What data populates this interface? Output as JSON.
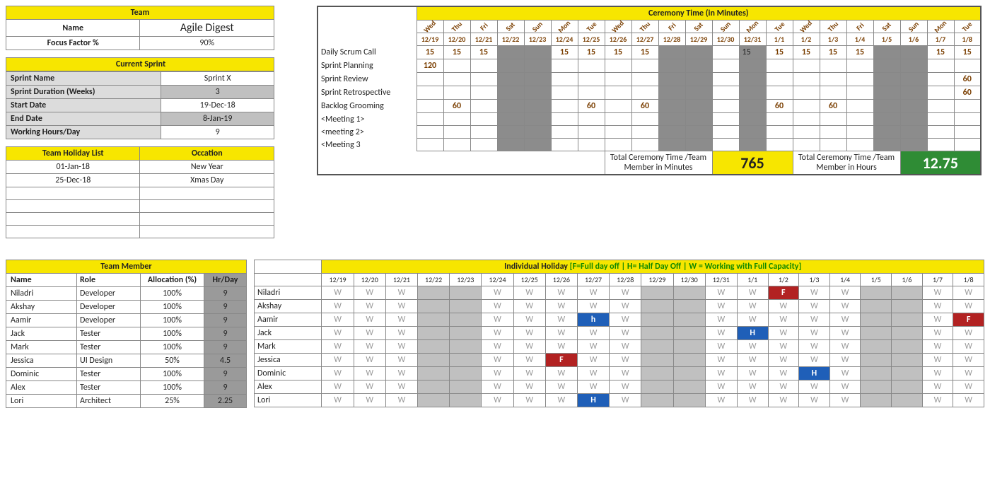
{
  "team": {
    "header": "Team",
    "name_label": "Name",
    "name_value": "Agile Digest",
    "focus_label": "Focus Factor %",
    "focus_value": "90%"
  },
  "sprint": {
    "header": "Current Sprint",
    "rows": [
      {
        "label": "Sprint Name",
        "value": "Sprint X"
      },
      {
        "label": "Sprint Duration (Weeks)",
        "value": "3",
        "grey_val": true
      },
      {
        "label": "Start Date",
        "value": "19-Dec-18"
      },
      {
        "label": "End Date",
        "value": "8-Jan-19",
        "grey_val": true
      },
      {
        "label": "Working Hours/Day",
        "value": "9"
      }
    ]
  },
  "holidays": {
    "h1": "Team Holiday List",
    "h2": "Occation",
    "rows": [
      {
        "date": "01-Jan-18",
        "occ": "New Year"
      },
      {
        "date": "25-Dec-18",
        "occ": "Xmas Day"
      },
      {
        "date": "",
        "occ": ""
      },
      {
        "date": "",
        "occ": ""
      },
      {
        "date": "",
        "occ": ""
      },
      {
        "date": "",
        "occ": ""
      }
    ]
  },
  "ceremony": {
    "title": "Ceremony Time (in Minutes)",
    "days": [
      "Wed",
      "Thu",
      "Fri",
      "Sat",
      "Sun",
      "Mon",
      "Tue",
      "Wed",
      "Thu",
      "Fri",
      "Sat",
      "Sun",
      "Mon",
      "Tue",
      "Wed",
      "Thu",
      "Fri",
      "Sat",
      "Sun",
      "Mon",
      "Tue"
    ],
    "dates": [
      "12/19",
      "12/20",
      "12/21",
      "12/22",
      "12/23",
      "12/24",
      "12/25",
      "12/26",
      "12/27",
      "12/28",
      "12/29",
      "12/30",
      "12/31",
      "1/1",
      "1/2",
      "1/3",
      "1/4",
      "1/5",
      "1/6",
      "1/7",
      "1/8"
    ],
    "grey_cols": [
      3,
      4,
      9,
      10,
      12,
      17,
      18
    ],
    "rows": [
      {
        "name": "Daily Scrum Call",
        "vals": [
          "15",
          "15",
          "15",
          "",
          "",
          "15",
          "15",
          "15",
          "15",
          "",
          "",
          "",
          "15",
          "15",
          "15",
          "15",
          "15",
          "",
          "",
          "15",
          "15"
        ]
      },
      {
        "name": "Sprint Planning",
        "vals": [
          "120",
          "",
          "",
          "",
          "",
          "",
          "",
          "",
          "",
          "",
          "",
          "",
          "",
          "",
          "",
          "",
          "",
          "",
          "",
          "",
          ""
        ]
      },
      {
        "name": "Sprint Review",
        "vals": [
          "",
          "",
          "",
          "",
          "",
          "",
          "",
          "",
          "",
          "",
          "",
          "",
          "",
          "",
          "",
          "",
          "",
          "",
          "",
          "",
          "60"
        ]
      },
      {
        "name": "Sprint Retrospective",
        "vals": [
          "",
          "",
          "",
          "",
          "",
          "",
          "",
          "",
          "",
          "",
          "",
          "",
          "",
          "",
          "",
          "",
          "",
          "",
          "",
          "",
          "60"
        ]
      },
      {
        "name": "Backlog Grooming",
        "vals": [
          "",
          "60",
          "",
          "",
          "",
          "",
          "60",
          "",
          "60",
          "",
          "",
          "",
          "",
          "60",
          "",
          "60",
          "",
          "",
          "",
          "",
          ""
        ]
      },
      {
        "name": "<Meeting 1>",
        "vals": [
          "",
          "",
          "",
          "",
          "",
          "",
          "",
          "",
          "",
          "",
          "",
          "",
          "",
          "",
          "",
          "",
          "",
          "",
          "",
          "",
          ""
        ]
      },
      {
        "name": "<meeting 2>",
        "vals": [
          "",
          "",
          "",
          "",
          "",
          "",
          "",
          "",
          "",
          "",
          "",
          "",
          "",
          "",
          "",
          "",
          "",
          "",
          "",
          "",
          ""
        ]
      },
      {
        "name": "<Meeting 3",
        "vals": [
          "",
          "",
          "",
          "",
          "",
          "",
          "",
          "",
          "",
          "",
          "",
          "",
          "",
          "",
          "",
          "",
          "",
          "",
          "",
          "",
          ""
        ]
      }
    ],
    "total_min_label": "Total Ceremony Time /Team Member in Minutes",
    "total_min_value": "765",
    "total_hr_label": "Total Ceremony Time /Team Member in Hours",
    "total_hr_value": "12.75"
  },
  "members": {
    "header": "Team Member",
    "cols": [
      "Name",
      "Role",
      "Allocation (%)",
      "Hr/Day"
    ],
    "rows": [
      {
        "name": "Niladri",
        "role": "Developer",
        "alloc": "100%",
        "hr": "9"
      },
      {
        "name": "Akshay",
        "role": "Developer",
        "alloc": "100%",
        "hr": "9"
      },
      {
        "name": "Aamir",
        "role": "Developer",
        "alloc": "100%",
        "hr": "9"
      },
      {
        "name": "Jack",
        "role": "Tester",
        "alloc": "100%",
        "hr": "9"
      },
      {
        "name": "Mark",
        "role": "Tester",
        "alloc": "100%",
        "hr": "9"
      },
      {
        "name": "Jessica",
        "role": "UI Design",
        "alloc": "50%",
        "hr": "4.5"
      },
      {
        "name": "Dominic",
        "role": "Tester",
        "alloc": "100%",
        "hr": "9"
      },
      {
        "name": "Alex",
        "role": "Tester",
        "alloc": "100%",
        "hr": "9"
      },
      {
        "name": "Lori",
        "role": "Architect",
        "alloc": "25%",
        "hr": "2.25"
      }
    ]
  },
  "indiv": {
    "title": "Individual Holiday",
    "legend": "[F=Full day off | H= Half Day Off | W = Working with Full Capacity]",
    "dates": [
      "12/19",
      "12/20",
      "12/21",
      "12/22",
      "12/23",
      "12/24",
      "12/25",
      "12/26",
      "12/27",
      "12/28",
      "12/29",
      "12/30",
      "12/31",
      "1/1",
      "1/2",
      "1/3",
      "1/4",
      "1/5",
      "1/6",
      "1/7",
      "1/8"
    ],
    "grey_cols": [
      3,
      4,
      10,
      11,
      17,
      18
    ],
    "rows": [
      {
        "name": "Niladri",
        "vals": [
          "W",
          "W",
          "W",
          "",
          "",
          "W",
          "W",
          "W",
          "W",
          "W",
          "",
          "",
          "W",
          "W",
          "F",
          "W",
          "W",
          "",
          "",
          "W",
          "W"
        ]
      },
      {
        "name": "Akshay",
        "vals": [
          "W",
          "W",
          "W",
          "",
          "",
          "W",
          "W",
          "W",
          "W",
          "W",
          "",
          "",
          "W",
          "W",
          "W",
          "W",
          "W",
          "",
          "",
          "W",
          "W"
        ]
      },
      {
        "name": "Aamir",
        "vals": [
          "W",
          "W",
          "W",
          "",
          "",
          "W",
          "W",
          "W",
          "h",
          "W",
          "",
          "",
          "W",
          "W",
          "W",
          "W",
          "W",
          "",
          "",
          "W",
          "F"
        ]
      },
      {
        "name": "Jack",
        "vals": [
          "W",
          "W",
          "W",
          "",
          "",
          "W",
          "W",
          "W",
          "W",
          "W",
          "",
          "",
          "W",
          "H",
          "W",
          "W",
          "W",
          "",
          "",
          "W",
          "W"
        ]
      },
      {
        "name": "Mark",
        "vals": [
          "W",
          "W",
          "W",
          "",
          "",
          "W",
          "W",
          "W",
          "W",
          "W",
          "",
          "",
          "W",
          "W",
          "W",
          "W",
          "W",
          "",
          "",
          "W",
          "W"
        ]
      },
      {
        "name": "Jessica",
        "vals": [
          "W",
          "W",
          "W",
          "",
          "",
          "W",
          "W",
          "F",
          "W",
          "W",
          "",
          "",
          "W",
          "W",
          "W",
          "W",
          "W",
          "",
          "",
          "W",
          "W"
        ]
      },
      {
        "name": "Dominic",
        "vals": [
          "W",
          "W",
          "W",
          "",
          "",
          "W",
          "W",
          "W",
          "W",
          "W",
          "",
          "",
          "W",
          "W",
          "W",
          "H",
          "W",
          "",
          "",
          "W",
          "W"
        ]
      },
      {
        "name": "Alex",
        "vals": [
          "W",
          "W",
          "W",
          "",
          "",
          "W",
          "W",
          "W",
          "W",
          "W",
          "",
          "",
          "W",
          "W",
          "W",
          "W",
          "W",
          "",
          "",
          "W",
          "W"
        ]
      },
      {
        "name": "Lori",
        "vals": [
          "W",
          "W",
          "W",
          "",
          "",
          "W",
          "W",
          "W",
          "H",
          "W",
          "",
          "",
          "W",
          "W",
          "W",
          "W",
          "W",
          "",
          "",
          "W",
          "W"
        ]
      }
    ]
  }
}
